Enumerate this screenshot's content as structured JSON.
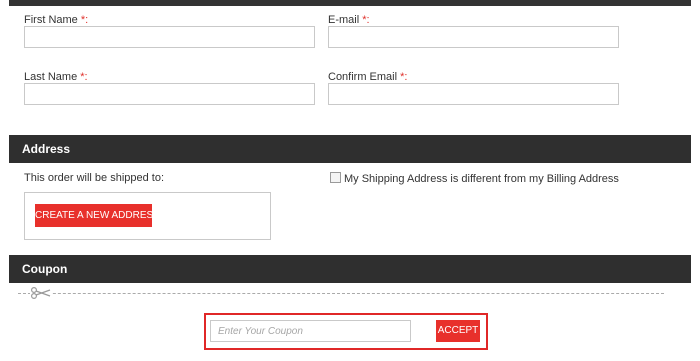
{
  "form": {
    "first_name_label": "First Name",
    "email_label": "E-mail",
    "last_name_label": "Last Name",
    "confirm_email_label": "Confirm Email",
    "required_marker": "*:"
  },
  "address": {
    "title": "Address",
    "shipped_to_text": "This order will be shipped to:",
    "different_shipping_label": "My Shipping Address is different from my Billing Address",
    "different_shipping_checked": false,
    "create_button_label": "CREATE A NEW ADDRESS"
  },
  "coupon": {
    "title": "Coupon",
    "input_placeholder": "Enter Your Coupon",
    "accept_button_label": "ACCEPT"
  },
  "colors": {
    "accent_red": "#e8302b",
    "bar_dark": "#2f2f2f"
  }
}
